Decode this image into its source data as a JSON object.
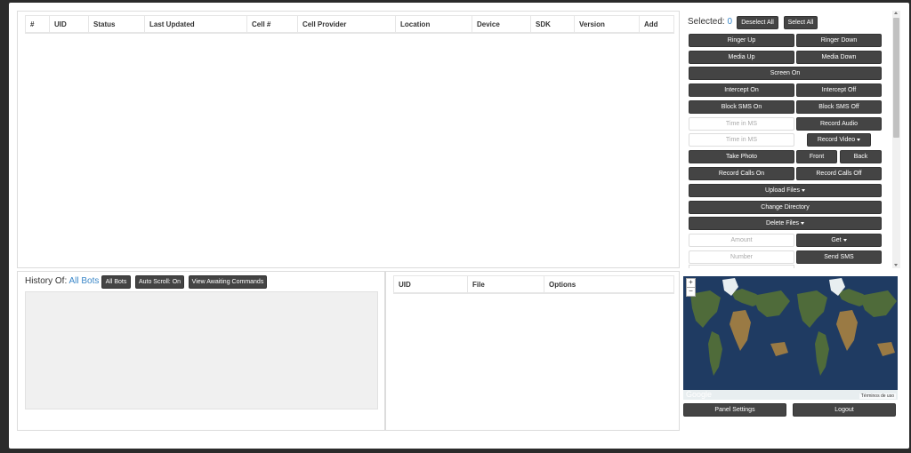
{
  "bots_table": {
    "columns": [
      "#",
      "UID",
      "Status",
      "Last Updated",
      "Cell #",
      "Cell Provider",
      "Location",
      "Device",
      "SDK",
      "Version",
      "Add"
    ]
  },
  "selection": {
    "label": "Selected:",
    "count": "0",
    "deselect_all": "Deselect All",
    "select_all": "Select All"
  },
  "controls": {
    "ringer_up": "Ringer Up",
    "ringer_down": "Ringer Down",
    "media_up": "Media Up",
    "media_down": "Media Down",
    "screen_on": "Screen On",
    "intercept_on": "Intercept On",
    "intercept_off": "Intercept Off",
    "block_sms_on": "Block SMS On",
    "block_sms_off": "Block SMS Off",
    "time_ms_placeholder_1": "Time in MS",
    "record_audio": "Record Audio",
    "time_ms_placeholder_2": "Time in MS",
    "record_video": "Record Video",
    "take_photo": "Take Photo",
    "front": "Front",
    "back": "Back",
    "record_calls_on": "Record Calls On",
    "record_calls_off": "Record Calls Off",
    "upload_files": "Upload Files",
    "change_directory": "Change Directory",
    "delete_files": "Delete Files",
    "amount_placeholder": "Amount",
    "get": "Get",
    "number_placeholder": "Number",
    "send_sms": "Send SMS"
  },
  "history": {
    "label": "History Of:",
    "target": "All Bots",
    "all_bots_button": "All Bots",
    "auto_scroll_button": "Auto Scroll: On",
    "view_awaiting_button": "View Awaiting Commands"
  },
  "files_table": {
    "columns": [
      "UID",
      "File",
      "Options"
    ]
  },
  "map": {
    "zoom_in": "+",
    "zoom_out": "−",
    "brand": "Google",
    "terms": "Términos de uso"
  },
  "footer": {
    "panel_settings": "Panel Settings",
    "logout": "Logout"
  }
}
